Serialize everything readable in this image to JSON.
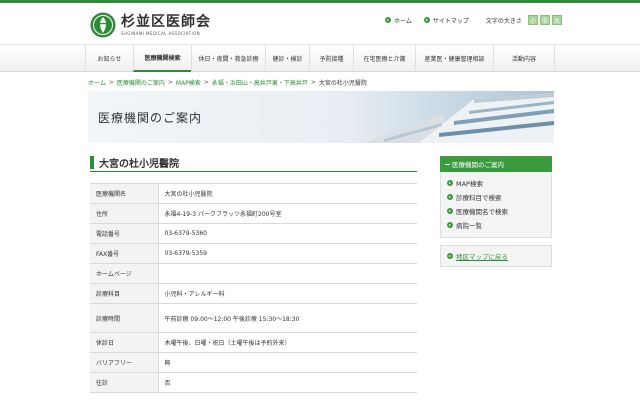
{
  "header": {
    "logo_name": "杉並区医師会",
    "logo_en": "SUGINAMI MEDICAL ASSOCIATION",
    "util_links": [
      "ホーム",
      "サイトマップ"
    ],
    "font_size_label": "文字の大きさ",
    "font_size_buttons": [
      "小",
      "中",
      "大"
    ]
  },
  "nav": {
    "items": [
      "お知らせ",
      "医療機関検索",
      "休日・夜間・救急診療",
      "健診・検診",
      "予防接種",
      "在宅医療と介護",
      "産業医・健康管理相談",
      "活動内容"
    ],
    "active_index": 1
  },
  "breadcrumb": {
    "links": [
      "ホーム",
      "医療機関のご案内",
      "MAP検索",
      "永福・浜田山・高井戸東・下高井戸"
    ],
    "current": "大宮の杜小児醫院"
  },
  "banner": {
    "title": "医療機関のご案内"
  },
  "main": {
    "title": "大宮の杜小児醫院",
    "rows": [
      {
        "key": "医療機関名",
        "value": "大宮の杜小児醫院"
      },
      {
        "key": "住所",
        "value": "永福4-19-3 パークフラッツ永福町200号室"
      },
      {
        "key": "電話番号",
        "value": "03-6379-5360"
      },
      {
        "key": "FAX番号",
        "value": "03-6379-5359"
      },
      {
        "key": "ホームページ",
        "value": ""
      },
      {
        "key": "診療科目",
        "value": "小児科・アレルギー科"
      },
      {
        "key": "診療時間",
        "value": "午前診療 09:00～12:00 午後診療 15:30～18:30"
      },
      {
        "key": "休診日",
        "value": "木曜午後、日曜・祝日（土曜午後は予約外来）"
      },
      {
        "key": "バリアフリー",
        "value": "無"
      },
      {
        "key": "往診",
        "value": "否"
      }
    ]
  },
  "side": {
    "heading": "医療機関のご案内",
    "items": [
      "MAP検索",
      "診療科目で検索",
      "医療機関名で検索",
      "病院一覧"
    ],
    "back_link": "地区マップに戻る"
  },
  "colors": {
    "accent": "#2e8b3a",
    "side_head": "#3b9b3e"
  }
}
